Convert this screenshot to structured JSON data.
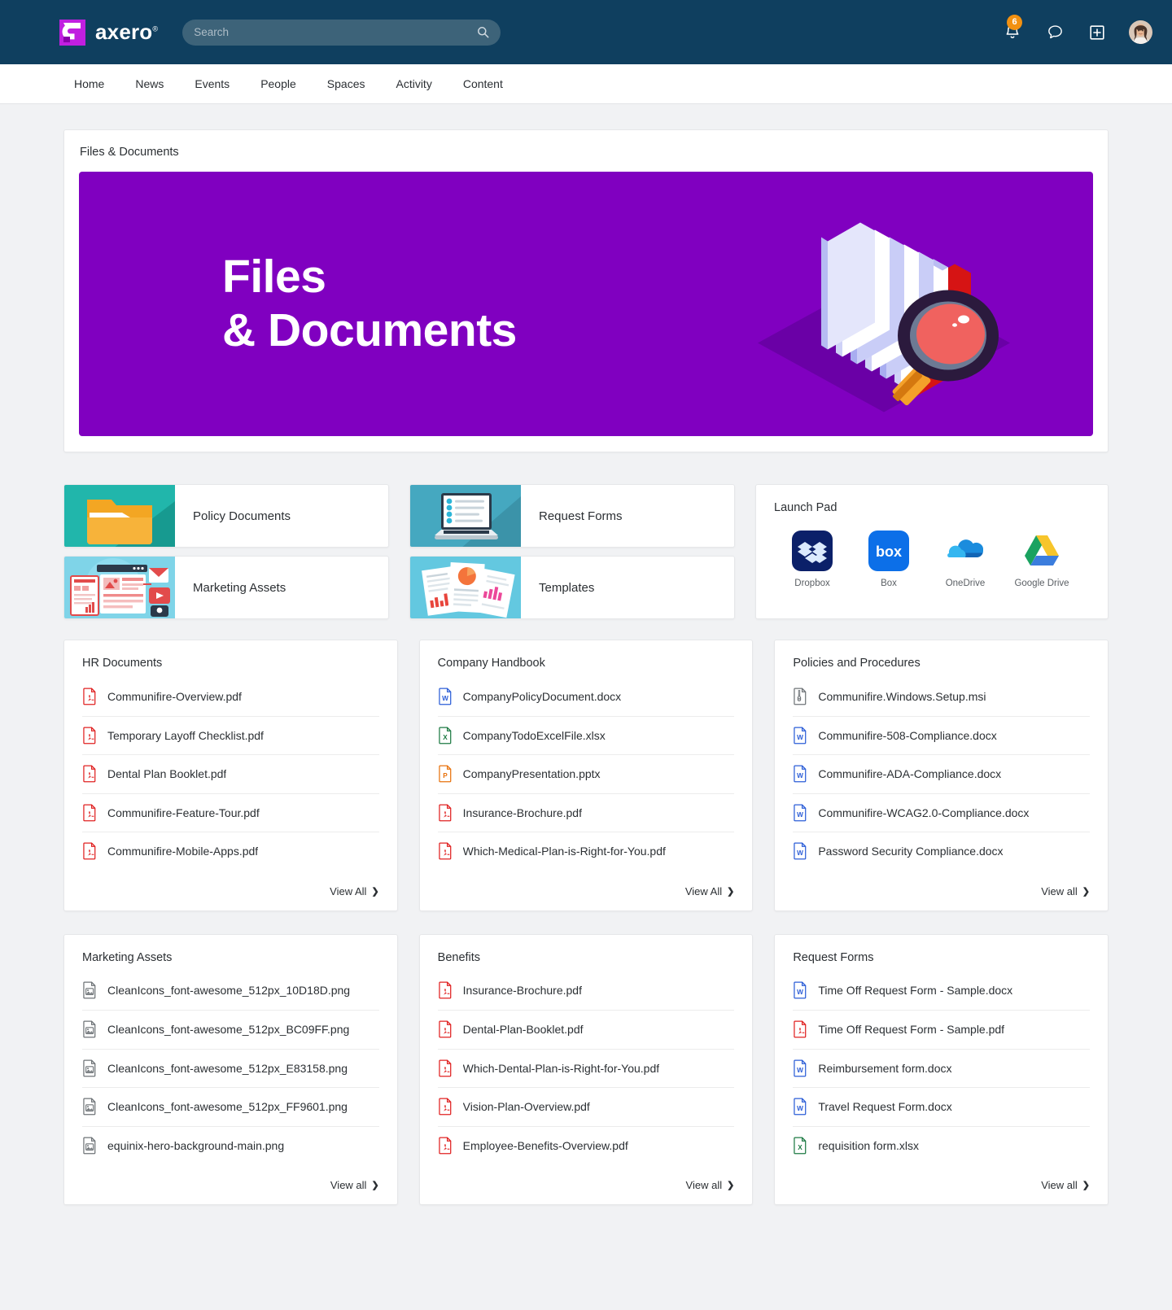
{
  "header": {
    "brand": "axero",
    "brand_tm": "®",
    "search_placeholder": "Search",
    "search_value": "",
    "notifications_badge": "6",
    "icons": {
      "search": "search-icon",
      "bell": "bell-icon",
      "chat": "chat-bubble-icon",
      "add": "add-box-icon",
      "avatar": "user-avatar"
    }
  },
  "nav": {
    "items": [
      {
        "label": "Home"
      },
      {
        "label": "News"
      },
      {
        "label": "Events"
      },
      {
        "label": "People"
      },
      {
        "label": "Spaces"
      },
      {
        "label": "Activity"
      },
      {
        "label": "Content"
      }
    ]
  },
  "hero": {
    "card_title": "Files & Documents",
    "banner_line1": "Files",
    "banner_line2": "& Documents",
    "banner_color": "#8000c0",
    "art": "isometric-file-folders-magnifier"
  },
  "tiles": {
    "left": [
      {
        "label": "Policy Documents",
        "thumb": "yellow-folder-illustration"
      },
      {
        "label": "Marketing Assets",
        "thumb": "marketing-dashboard-illustration"
      }
    ],
    "middle": [
      {
        "label": "Request Forms",
        "thumb": "laptop-checklist-illustration"
      },
      {
        "label": "Templates",
        "thumb": "documents-charts-illustration"
      }
    ]
  },
  "launch_pad": {
    "title": "Launch Pad",
    "apps": [
      {
        "name": "Dropbox",
        "icon": "dropbox-icon",
        "color": "#0b2069"
      },
      {
        "name": "Box",
        "icon": "box-icon",
        "color": "#0d6efd"
      },
      {
        "name": "OneDrive",
        "icon": "onedrive-icon",
        "color": "#1f8ce0"
      },
      {
        "name": "Google Drive",
        "icon": "google-drive-icon",
        "color": "#f7c52b"
      }
    ]
  },
  "panels": [
    {
      "title": "HR Documents",
      "view_all": "View All",
      "files": [
        {
          "name": "Communifire-Overview.pdf",
          "type": "pdf"
        },
        {
          "name": "Temporary Layoff Checklist.pdf",
          "type": "pdf"
        },
        {
          "name": "Dental Plan Booklet.pdf",
          "type": "pdf"
        },
        {
          "name": "Communifire-Feature-Tour.pdf",
          "type": "pdf"
        },
        {
          "name": "Communifire-Mobile-Apps.pdf",
          "type": "pdf"
        }
      ]
    },
    {
      "title": "Company Handbook",
      "view_all": "View All",
      "files": [
        {
          "name": "CompanyPolicyDocument.docx",
          "type": "docx"
        },
        {
          "name": "CompanyTodoExcelFile.xlsx",
          "type": "xlsx"
        },
        {
          "name": "CompanyPresentation.pptx",
          "type": "pptx"
        },
        {
          "name": "Insurance-Brochure.pdf",
          "type": "pdf"
        },
        {
          "name": "Which-Medical-Plan-is-Right-for-You.pdf",
          "type": "pdf"
        }
      ]
    },
    {
      "title": "Policies and Procedures",
      "view_all": "View all",
      "files": [
        {
          "name": "Communifire.Windows.Setup.msi",
          "type": "msi"
        },
        {
          "name": "Communifire-508-Compliance.docx",
          "type": "docx"
        },
        {
          "name": "Communifire-ADA-Compliance.docx",
          "type": "docx"
        },
        {
          "name": "Communifire-WCAG2.0-Compliance.docx",
          "type": "docx"
        },
        {
          "name": "Password Security Compliance.docx",
          "type": "docx"
        }
      ]
    },
    {
      "title": "Marketing Assets",
      "view_all": "View all",
      "files": [
        {
          "name": "CleanIcons_font-awesome_512px_10D18D.png",
          "type": "png"
        },
        {
          "name": "CleanIcons_font-awesome_512px_BC09FF.png",
          "type": "png"
        },
        {
          "name": "CleanIcons_font-awesome_512px_E83158.png",
          "type": "png"
        },
        {
          "name": "CleanIcons_font-awesome_512px_FF9601.png",
          "type": "png"
        },
        {
          "name": "equinix-hero-background-main.png",
          "type": "png"
        }
      ]
    },
    {
      "title": "Benefits",
      "view_all": "View all",
      "files": [
        {
          "name": "Insurance-Brochure.pdf",
          "type": "pdf"
        },
        {
          "name": "Dental-Plan-Booklet.pdf",
          "type": "pdf"
        },
        {
          "name": "Which-Dental-Plan-is-Right-for-You.pdf",
          "type": "pdf"
        },
        {
          "name": "Vision-Plan-Overview.pdf",
          "type": "pdf"
        },
        {
          "name": "Employee-Benefits-Overview.pdf",
          "type": "pdf"
        }
      ]
    },
    {
      "title": "Request Forms",
      "view_all": "View all",
      "files": [
        {
          "name": "Time Off Request Form - Sample.docx",
          "type": "docx"
        },
        {
          "name": "Time Off Request Form - Sample.pdf",
          "type": "pdf"
        },
        {
          "name": "Reimbursement form.docx",
          "type": "docx"
        },
        {
          "name": "Travel Request Form.docx",
          "type": "docx"
        },
        {
          "name": "requisition form.xlsx",
          "type": "xlsx"
        }
      ]
    }
  ],
  "colors": {
    "topbar": "#0f3f5f",
    "accent_purple": "#8000c0",
    "badge_orange": "#f29111",
    "pdf_red": "#e02020",
    "word_blue": "#2b5dd7",
    "excel_green": "#1d7a43",
    "ppt_orange": "#e8720c",
    "file_gray": "#6e7377"
  }
}
